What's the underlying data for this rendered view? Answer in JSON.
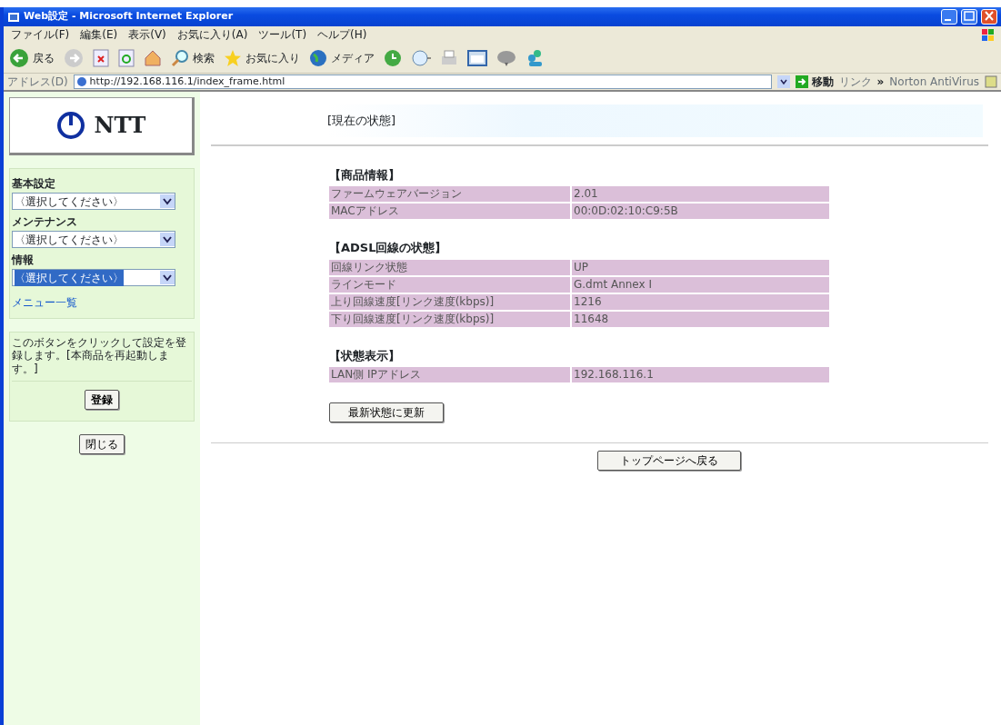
{
  "window": {
    "title": "Web設定 - Microsoft Internet Explorer"
  },
  "menu_bar": [
    "ファイル(F)",
    "編集(E)",
    "表示(V)",
    "お気に入り(A)",
    "ツール(T)",
    "ヘルプ(H)"
  ],
  "toolbar": {
    "back": "戻る",
    "search": "検索",
    "favorites": "お気に入り",
    "media": "メディア"
  },
  "address_bar": {
    "label": "アドレス(D)",
    "url": "http://192.168.116.1/index_frame.html",
    "go": "移動",
    "links": "リンク",
    "more": "»",
    "addon": "Norton AntiVirus"
  },
  "sidebar": {
    "logo": "NTT",
    "menus": [
      {
        "label": "基本設定",
        "value": "〈選択してください〉",
        "focused": false
      },
      {
        "label": "メンテナンス",
        "value": "〈選択してください〉",
        "focused": false
      },
      {
        "label": "情報",
        "value": "〈選択してください〉",
        "focused": true
      }
    ],
    "menu_link": "メニュー一覧",
    "note": "このボタンをクリックして設定を登録します。[本商品を再起動します。]",
    "register_button": "登録",
    "close_button": "閉じる"
  },
  "main": {
    "title": "[現在の状態]",
    "sections": [
      {
        "heading": "【商品情報】",
        "rows": [
          [
            "ファームウェアバージョン",
            "2.01"
          ],
          [
            "MACアドレス",
            "00:0D:02:10:C9:5B"
          ]
        ]
      },
      {
        "heading": "【ADSL回線の状態】",
        "rows": [
          [
            "回線リンク状態",
            "UP"
          ],
          [
            "ラインモード",
            "G.dmt Annex I"
          ],
          [
            "上り回線速度[リンク速度(kbps)]",
            "1216"
          ],
          [
            "下り回線速度[リンク速度(kbps)]",
            "11648"
          ]
        ]
      },
      {
        "heading": "【状態表示】",
        "rows": [
          [
            "LAN側 IPアドレス",
            "192.168.116.1"
          ]
        ]
      }
    ],
    "refresh_button": "最新状態に更新",
    "top_button": "トップページへ戻る"
  }
}
